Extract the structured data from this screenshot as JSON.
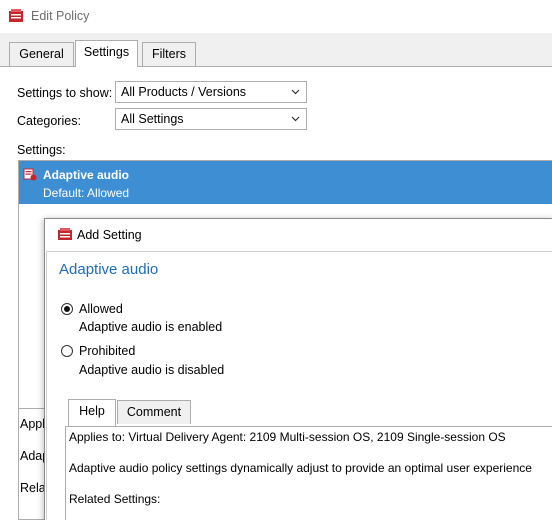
{
  "window": {
    "title": "Edit Policy"
  },
  "tabs": [
    {
      "label": "General"
    },
    {
      "label": "Settings"
    },
    {
      "label": "Filters"
    }
  ],
  "filters": {
    "settings_to_show_label": "Settings to show:",
    "settings_to_show_value": "All Products / Versions",
    "categories_label": "Categories:",
    "categories_value": "All Settings"
  },
  "settings_list": {
    "label": "Settings:",
    "selected": {
      "name": "Adaptive audio",
      "default": "Default: Allowed"
    }
  },
  "lower_labels": [
    "Appli",
    "Adap",
    "Relat"
  ],
  "dialog": {
    "title": "Add Setting",
    "heading": "Adaptive audio",
    "options": [
      {
        "label": "Allowed",
        "description": "Adaptive audio is enabled",
        "selected": true
      },
      {
        "label": "Prohibited",
        "description": "Adaptive audio is disabled",
        "selected": false
      }
    ],
    "tabs": [
      {
        "label": "Help"
      },
      {
        "label": "Comment"
      }
    ],
    "help": {
      "applies_to": "Applies to: Virtual Delivery Agent: 2109 Multi-session OS, 2109 Single-session OS",
      "description": "Adaptive audio policy settings dynamically adjust to provide an optimal user experience",
      "related": "Related Settings:"
    }
  },
  "colors": {
    "selection": "#3e8ed3",
    "heading": "#1d6db8",
    "icon_red": "#c4262e"
  },
  "icons": {
    "app": "policy-icon",
    "setting": "setting-gear-icon",
    "chevron": "chevron-down-icon"
  }
}
